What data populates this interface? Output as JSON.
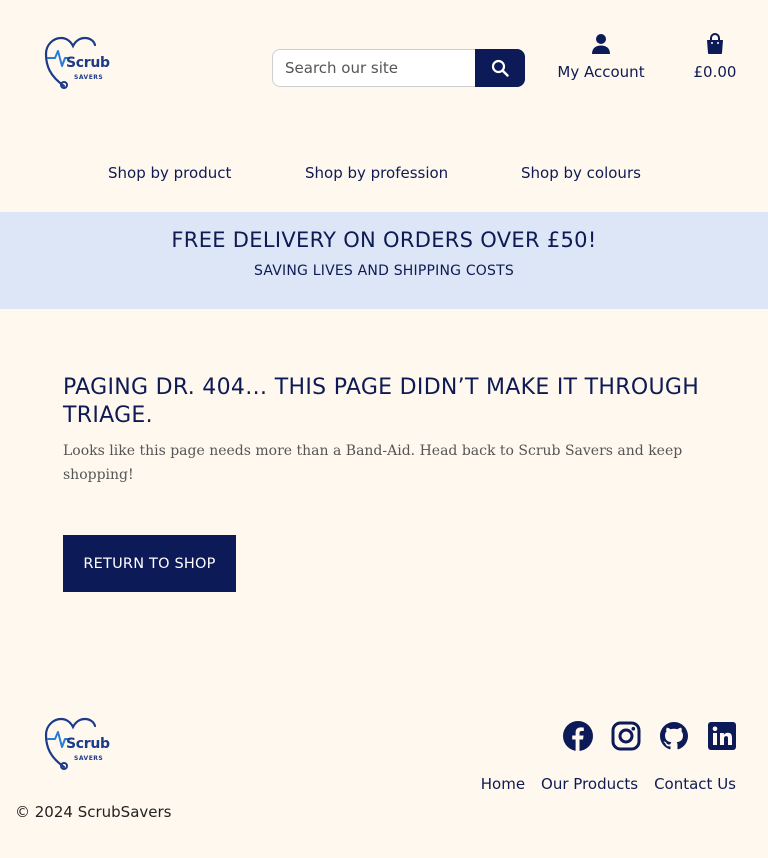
{
  "brand": {
    "word": "Scrub",
    "sub": "SAVERS"
  },
  "search": {
    "placeholder": "Search our site"
  },
  "header": {
    "account_label": "My Account",
    "cart_total": "£0.00"
  },
  "nav": {
    "items": [
      "Shop by product",
      "Shop by profession",
      "Shop by colours"
    ]
  },
  "banner": {
    "headline": "FREE DELIVERY ON ORDERS OVER £50!",
    "subline": "SAVING LIVES AND SHIPPING COSTS"
  },
  "main": {
    "title": "PAGING DR. 404… THIS PAGE DIDN’T MAKE IT THROUGH TRIAGE.",
    "body": "Looks like this page needs more than a Band-Aid. Head back to Scrub Savers and keep shopping!",
    "cta": "RETURN TO SHOP"
  },
  "footer": {
    "socials": [
      "facebook-icon",
      "instagram-icon",
      "github-icon",
      "linkedin-icon"
    ],
    "links": [
      "Home",
      "Our Products",
      "Contact Us"
    ],
    "copyright": "© 2024 ScrubSavers"
  },
  "colors": {
    "primary": "#0c1a57",
    "background": "#fff8ee",
    "banner": "#dce6f6"
  }
}
